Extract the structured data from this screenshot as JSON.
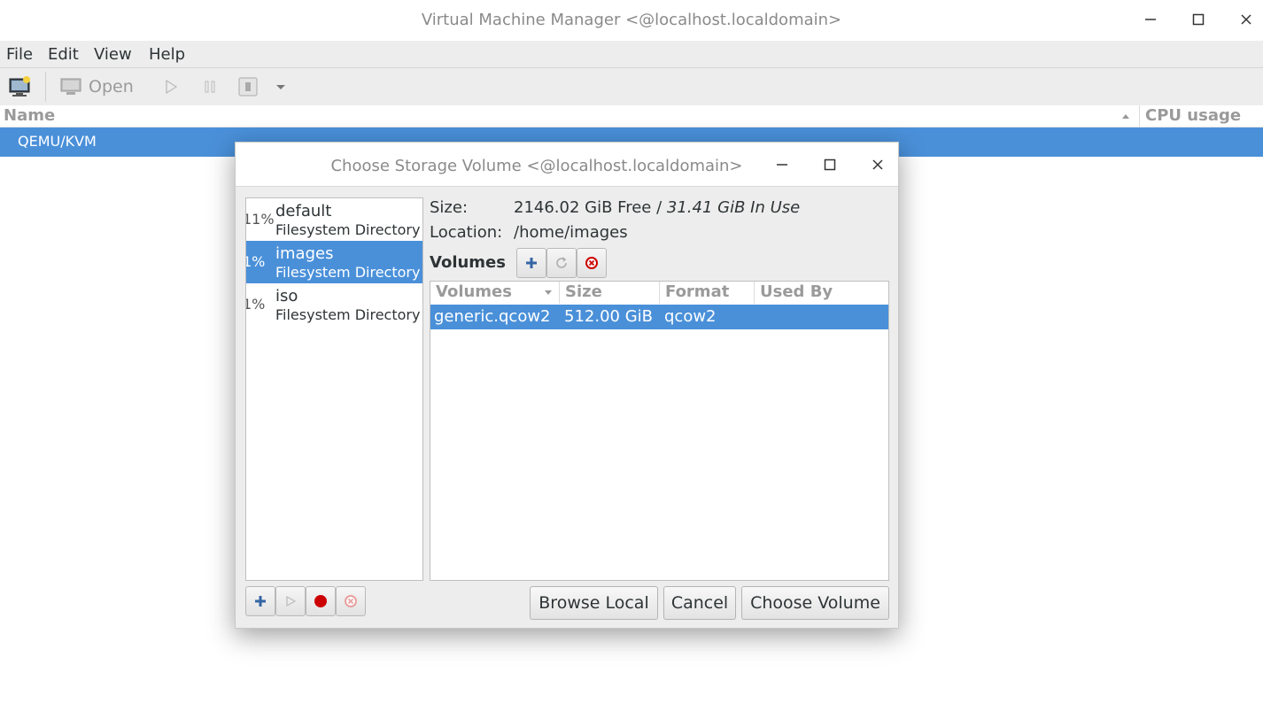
{
  "window": {
    "title": "Virtual Machine Manager <@localhost.localdomain>"
  },
  "menu": [
    "File",
    "Edit",
    "View",
    "Help"
  ],
  "toolbar": {
    "open_label": "Open"
  },
  "vm_list": {
    "columns": [
      "Name",
      "CPU usage"
    ],
    "rows": [
      "QEMU/KVM"
    ]
  },
  "dialog": {
    "title": "Choose Storage Volume <@localhost.localdomain>",
    "pools": [
      {
        "percent": "11%",
        "name": "default",
        "type": "Filesystem Directory"
      },
      {
        "percent": "1%",
        "name": "images",
        "type": "Filesystem Directory"
      },
      {
        "percent": "1%",
        "name": "iso",
        "type": "Filesystem Directory"
      }
    ],
    "selected_pool": "images",
    "size_label": "Size:",
    "size_free": "2146.02 GiB Free / ",
    "size_in_use": "31.41 GiB In Use",
    "location_label": "Location:",
    "location_value": "/home/images",
    "volumes_label": "Volumes",
    "volume_columns": [
      "Volumes",
      "Size",
      "Format",
      "Used By"
    ],
    "volumes": [
      {
        "name": "generic.qcow2",
        "size": "512.00 GiB",
        "format": "qcow2",
        "used_by": ""
      }
    ],
    "buttons": {
      "browse_local": "Browse Local",
      "cancel": "Cancel",
      "choose_volume": "Choose Volume"
    }
  },
  "colors": {
    "selection": "#4a90d9",
    "stop_red": "#cc0000"
  }
}
